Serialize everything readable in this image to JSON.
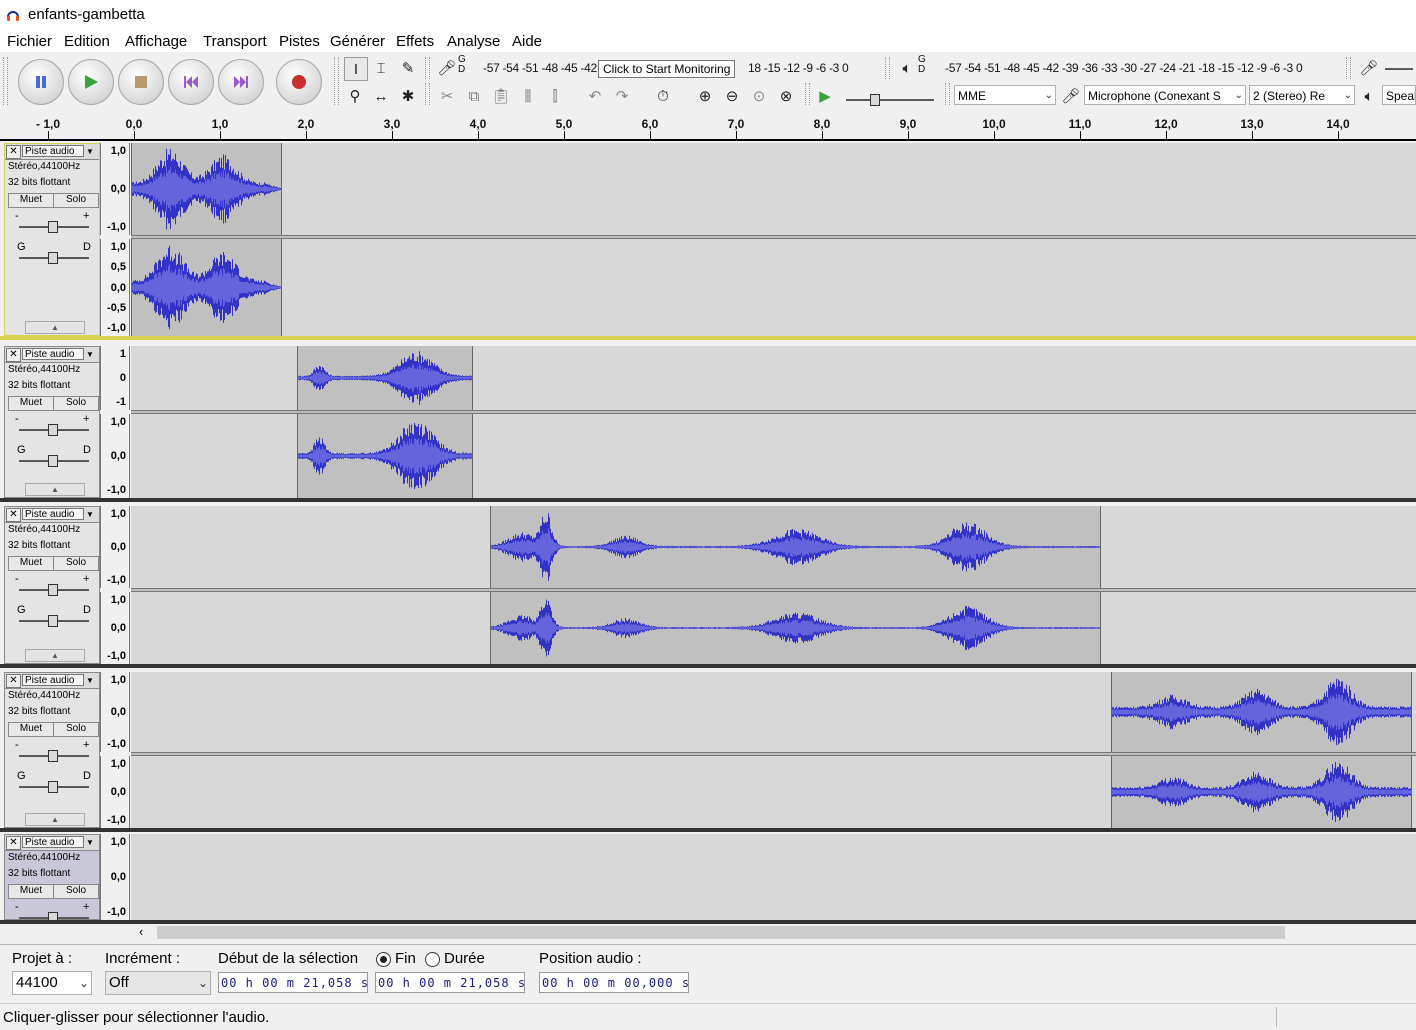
{
  "window": {
    "title": "enfants-gambetta"
  },
  "menu": [
    "Fichier",
    "Edition",
    "Affichage",
    "Transport",
    "Pistes",
    "Générer",
    "Effets",
    "Analyse",
    "Aide"
  ],
  "transport": {
    "pause_icon": "pause-icon",
    "play_icon": "play-icon",
    "stop_icon": "stop-icon",
    "skip_start_icon": "skip-start-icon",
    "skip_end_icon": "skip-end-icon",
    "record_icon": "record-icon"
  },
  "meters": {
    "record_scale": "-57 -54 -51 -48 -45 -42",
    "record_tooltip": "Click to Start Monitoring",
    "record_scale_tail": "18 -15 -12  -9  -6  -3  0",
    "record_gd": "G D",
    "play_scale": "-57 -54 -51 -48 -45 -42 -39 -36 -33 -30 -27 -24 -21 -18 -15 -12  -9  -6  -3  0",
    "play_gd": "G D"
  },
  "device": {
    "host": "MME",
    "input": "Microphone (Conexant S",
    "channels": "2 (Stereo) Re",
    "output": "Speal"
  },
  "ruler": {
    "labels": [
      "- 1,0",
      "0,0",
      "1,0",
      "2,0",
      "3,0",
      "4,0",
      "5,0",
      "6,0",
      "7,0",
      "8,0",
      "9,0",
      "10,0",
      "11,0",
      "12,0",
      "13,0",
      "14,0"
    ]
  },
  "tracks": [
    {
      "name": "Piste audio",
      "info1": "Stéréo,44100Hz",
      "info2": "32 bits flottant",
      "mute": "Muet",
      "solo": "Solo",
      "gain_minus": "-",
      "gain_plus": "+",
      "pan_left": "G",
      "pan_right": "D",
      "scale_top": [
        "1,0",
        "0,0",
        "-1,0"
      ],
      "scale_bottom": [
        "1,0",
        "0,5",
        "0,0",
        "-0,5",
        "-1,0"
      ],
      "clip_start": 0.0,
      "clip_end": 1.75
    },
    {
      "name": "Piste audio",
      "info1": "Stéréo,44100Hz",
      "info2": "32 bits flottant",
      "mute": "Muet",
      "solo": "Solo",
      "gain_minus": "-",
      "gain_plus": "+",
      "pan_left": "G",
      "pan_right": "D",
      "scale_top": [
        "1",
        "0",
        "-1"
      ],
      "scale_bottom": [
        "1,0",
        "0,0",
        "-1,0"
      ],
      "clip_start": 1.93,
      "clip_end": 3.98
    },
    {
      "name": "Piste audio",
      "info1": "Stéréo,44100Hz",
      "info2": "32 bits flottant",
      "mute": "Muet",
      "solo": "Solo",
      "gain_minus": "-",
      "gain_plus": "+",
      "pan_left": "G",
      "pan_right": "D",
      "scale_top": [
        "1,0",
        "0,0",
        "-1,0"
      ],
      "scale_bottom": [
        "1,0",
        "0,0",
        "-1,0"
      ],
      "clip_start": 4.18,
      "clip_end": 11.28
    },
    {
      "name": "Piste audio",
      "info1": "Stéréo,44100Hz",
      "info2": "32 bits flottant",
      "mute": "Muet",
      "solo": "Solo",
      "gain_minus": "-",
      "gain_plus": "+",
      "pan_left": "G",
      "pan_right": "D",
      "scale_top": [
        "1,0",
        "0,0",
        "-1,0"
      ],
      "scale_bottom": [
        "1,0",
        "0,0",
        "-1,0"
      ],
      "clip_start": 11.4,
      "clip_end": 14.9
    },
    {
      "name": "Piste audio",
      "info1": "Stéréo,44100Hz",
      "info2": "32 bits flottant",
      "mute": "Muet",
      "solo": "Solo",
      "gain_minus": "-",
      "gain_plus": "+",
      "scale_top": [
        "1,0",
        "0,0",
        "-1,0"
      ]
    }
  ],
  "selection": {
    "project_rate_label": "Projet à :",
    "project_rate": "44100",
    "snap_label": "Incrément :",
    "snap_value": "Off",
    "start_label": "Début de la sélection",
    "start_value": "00 h 00 m 21,058 s",
    "end_option": "Fin",
    "duration_option": "Durée",
    "end_value": "00 h 00 m 21,058 s",
    "audio_pos_label": "Position audio :",
    "audio_pos_value": "00 h 00 m 00,000 s"
  },
  "status": {
    "text": "Cliquer-glisser pour sélectionner l'audio."
  },
  "colors": {
    "waveform": "#3232c8",
    "waveform_rms": "#6464dc",
    "clip_bg": "#c0c0c0",
    "selected_track_border": "#d8d050"
  }
}
